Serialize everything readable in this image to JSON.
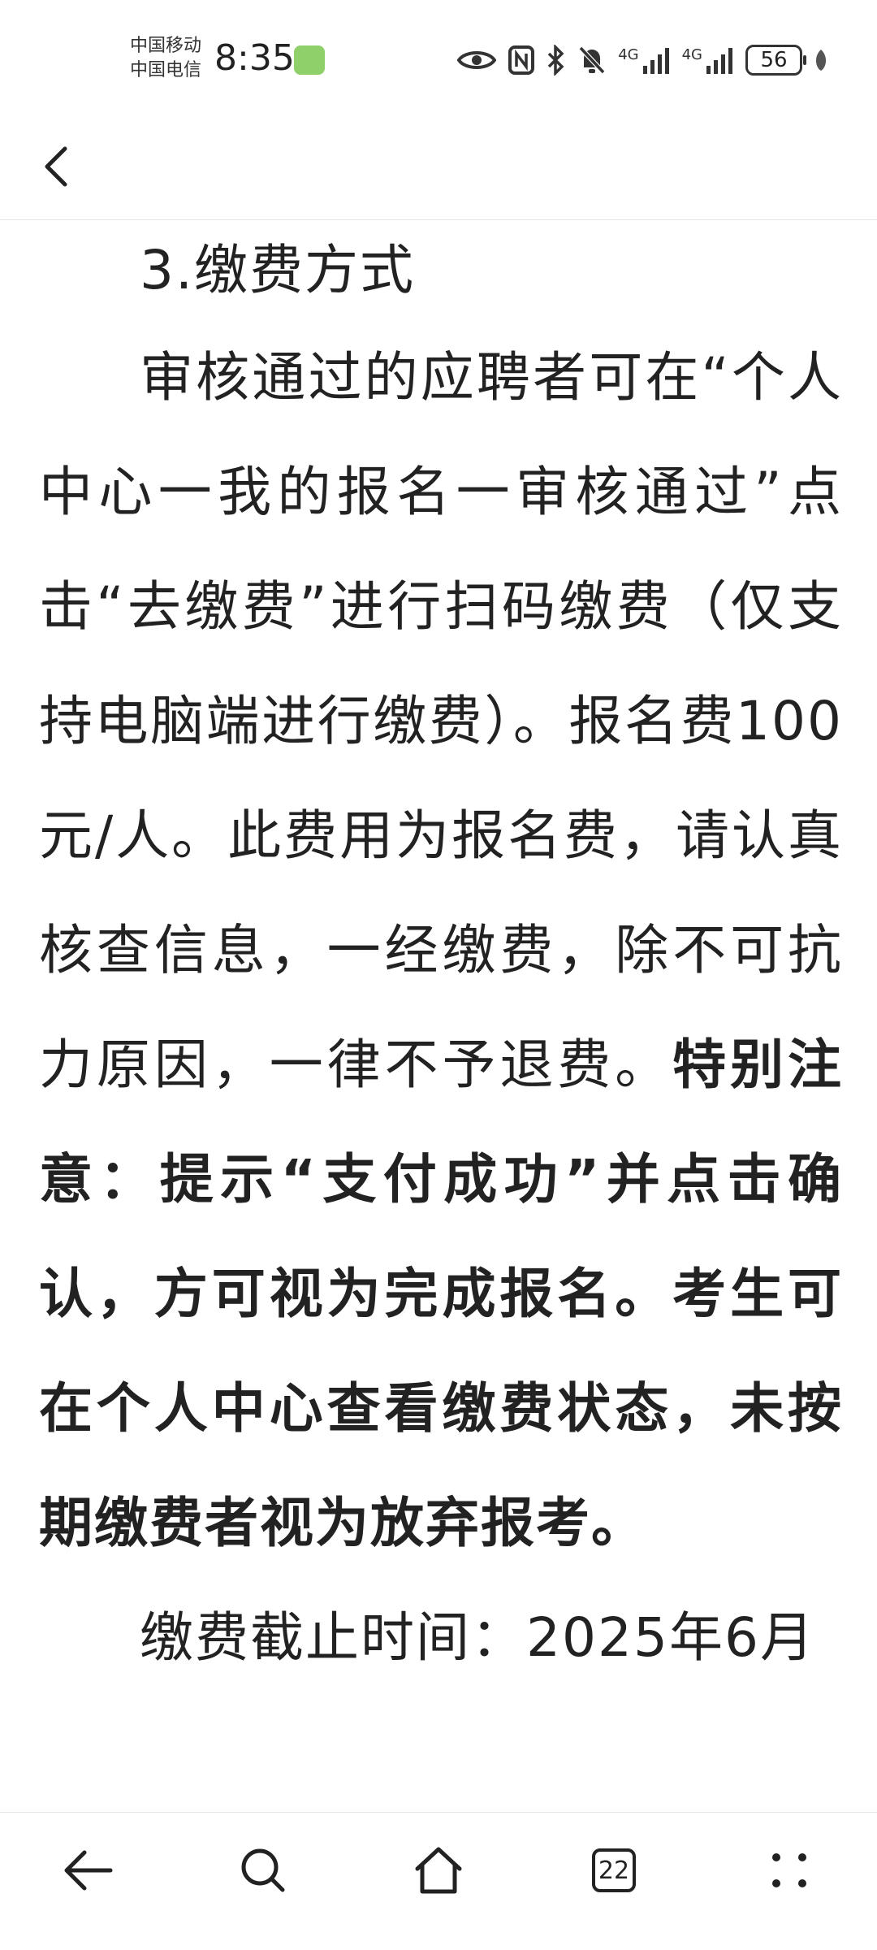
{
  "status_bar": {
    "carrier_1": "中国移动",
    "carrier_2": "中国电信",
    "time": "8:35",
    "network_1": "4G",
    "network_2": "4G",
    "battery": "56"
  },
  "article": {
    "heading": "3.缴费方式",
    "paragraph_normal": "审核通过的应聘者可在“个人中心一我的报名一审核通过”点击“去缴费”进行扫码缴费（仅支持电脑端进行缴费）。报名费100元/人。此费用为报名费，请认真核查信息，一经缴费，除不可抗力原因，一律不予退费。",
    "paragraph_bold": "特别注意：提示“支付成功”并点击确认，方可视为完成报名。考生可在个人中心查看缴费状态，未按期缴费者视为放弃报考。",
    "deadline": "缴费截止时间：2025年6月"
  },
  "bottom_nav": {
    "tabs_count": "22"
  },
  "colors": {
    "text": "#222222",
    "background": "#ffffff",
    "divider": "#e3e3e3"
  }
}
